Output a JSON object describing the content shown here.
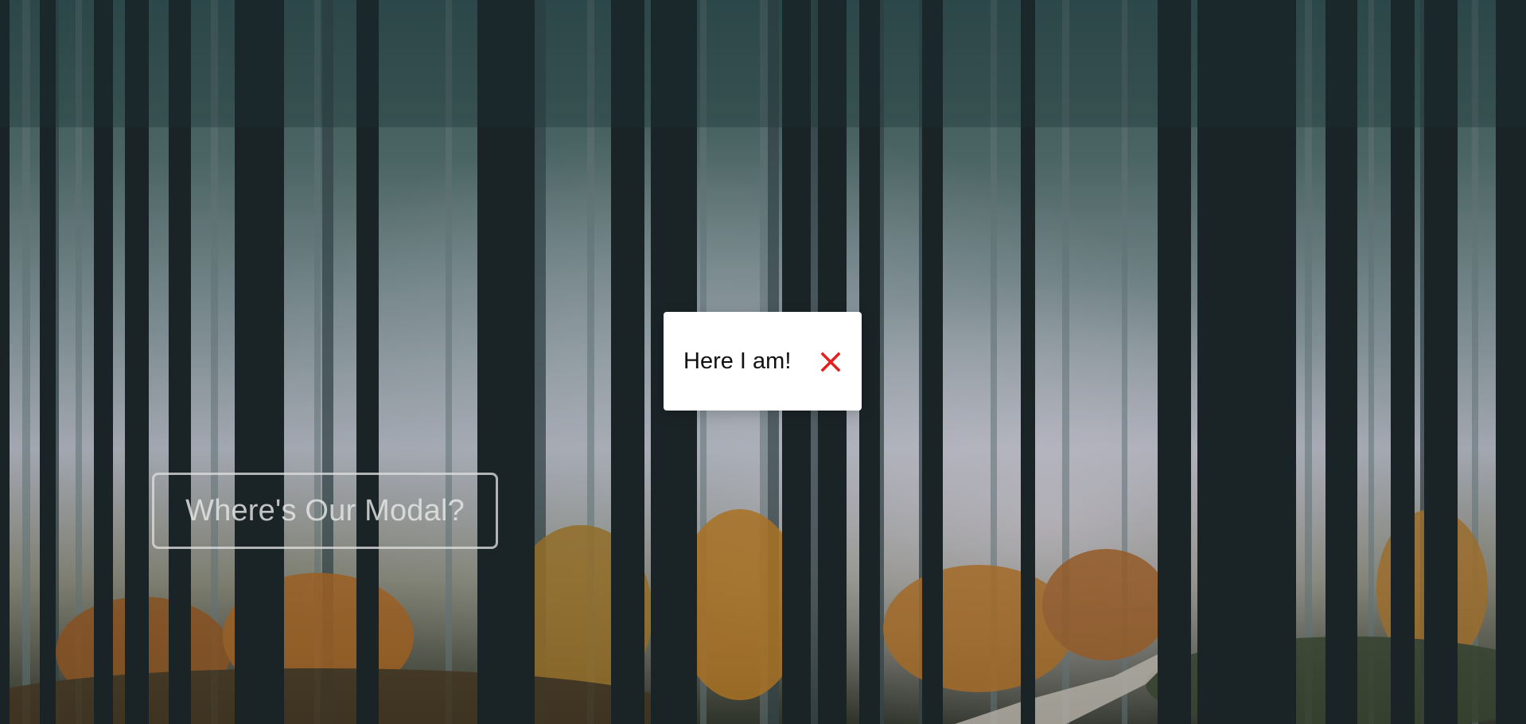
{
  "background": {
    "scene": "misty pine forest with autumn foliage and a dirt path"
  },
  "open_button": {
    "label": "Where's Our Modal?"
  },
  "modal": {
    "text": "Here I am!",
    "close_icon": "close-icon",
    "close_color": "#e51e1e"
  },
  "colors": {
    "modal_background": "#ffffff",
    "button_border": "#dcdcdc",
    "button_text": "#e6e6e6"
  }
}
